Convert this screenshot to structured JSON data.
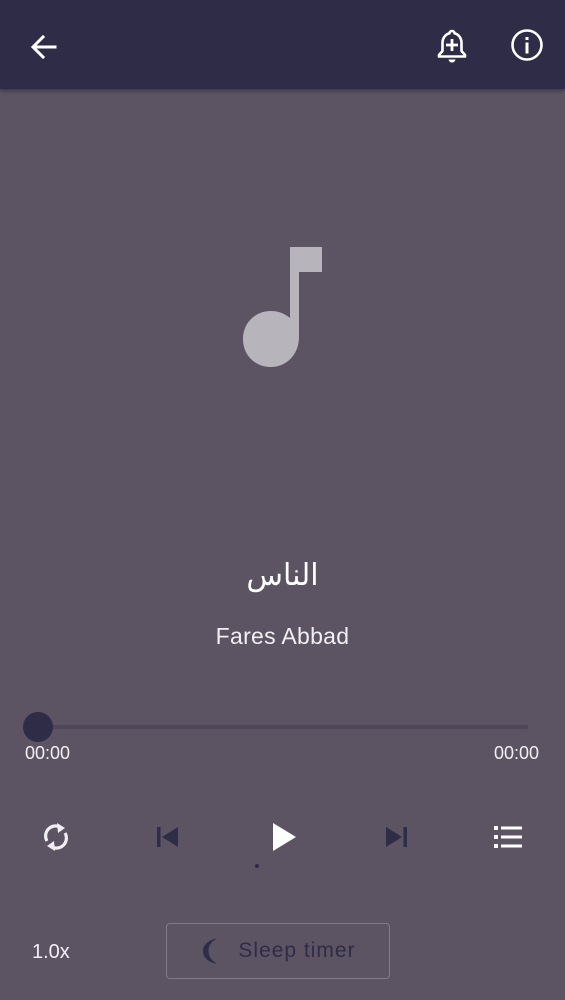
{
  "header": {
    "back_icon": "arrow-left-icon",
    "bell_icon": "add-alarm-bell-icon",
    "info_icon": "info-circle-icon"
  },
  "artwork": {
    "icon": "music-note-icon",
    "color": "#b8b4bb"
  },
  "track": {
    "title": "الناس",
    "artist": "Fares Abbad"
  },
  "progress": {
    "value": 0,
    "current_time": "00:00",
    "total_time": "00:00"
  },
  "controls": {
    "repeat_icon": "repeat-icon",
    "previous_icon": "skip-previous-icon",
    "play_icon": "play-icon",
    "next_icon": "skip-next-icon",
    "playlist_icon": "playlist-icon"
  },
  "footer": {
    "speed": "1.0x",
    "sleep_timer_label": "Sleep timer",
    "sleep_icon": "moon-icon"
  },
  "colors": {
    "background": "#5d5463",
    "appbar": "#2f2c47",
    "accent": "#2f2c47",
    "text": "#ffffff"
  }
}
